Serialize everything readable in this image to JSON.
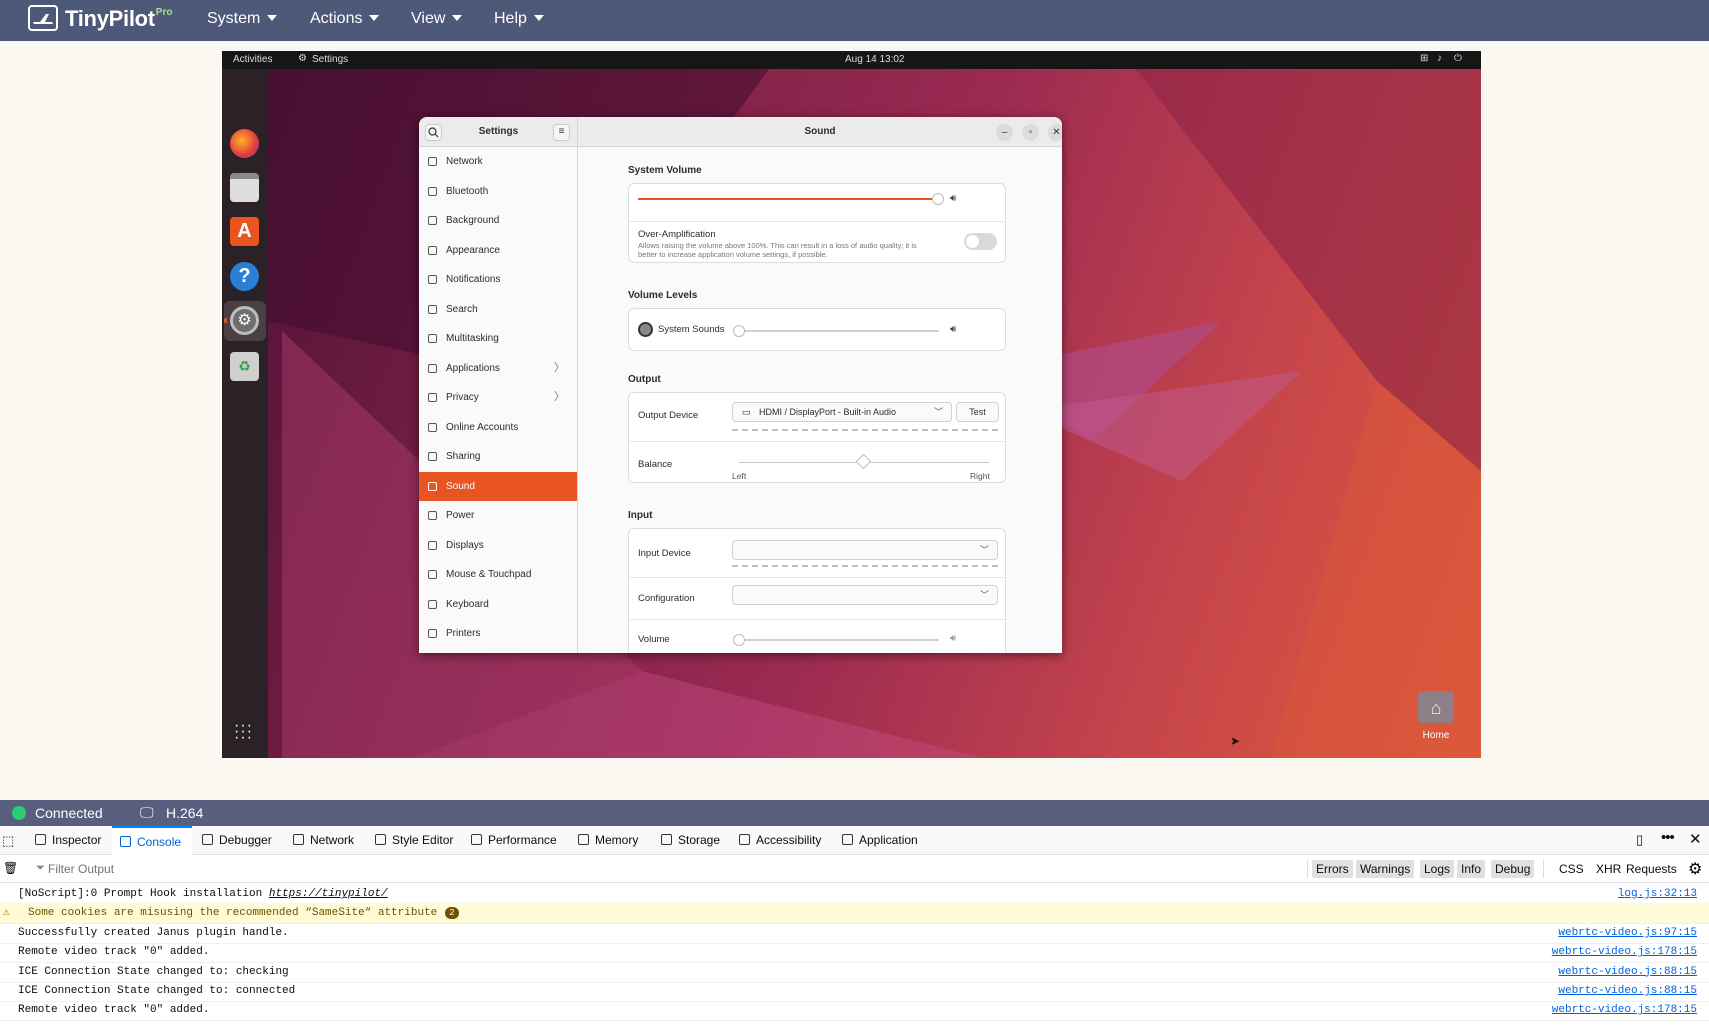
{
  "topbar": {
    "logo_text": "TinyPilot",
    "logo_pro": "Pro",
    "menus": [
      "System",
      "Actions",
      "View",
      "Help"
    ]
  },
  "remote": {
    "gnome_bar": {
      "activities": "Activities",
      "app": "Settings",
      "clock": "Aug 14  13:02"
    },
    "desktop_home_label": "Home",
    "settings": {
      "sidebar_title": "Settings",
      "panel_title": "Sound",
      "sidebar_items": [
        {
          "label": "Network",
          "chevron": ""
        },
        {
          "label": "Bluetooth",
          "chevron": ""
        },
        {
          "label": "Background",
          "chevron": ""
        },
        {
          "label": "Appearance",
          "chevron": ""
        },
        {
          "label": "Notifications",
          "chevron": ""
        },
        {
          "label": "Search",
          "chevron": ""
        },
        {
          "label": "Multitasking",
          "chevron": ""
        },
        {
          "label": "Applications",
          "chevron": "〉"
        },
        {
          "label": "Privacy",
          "chevron": "〉"
        },
        {
          "label": "Online Accounts",
          "chevron": ""
        },
        {
          "label": "Sharing",
          "chevron": ""
        },
        {
          "label": "Sound",
          "chevron": ""
        },
        {
          "label": "Power",
          "chevron": ""
        },
        {
          "label": "Displays",
          "chevron": ""
        },
        {
          "label": "Mouse & Touchpad",
          "chevron": ""
        },
        {
          "label": "Keyboard",
          "chevron": ""
        },
        {
          "label": "Printers",
          "chevron": ""
        }
      ],
      "active_item": "Sound",
      "system_volume_heading": "System Volume",
      "system_volume_level": 1.0,
      "over_amp_title": "Over-Amplification",
      "over_amp_desc": "Allows raising the volume above 100%. This can result in a loss of audio quality; it is better to increase application volume settings, if possible.",
      "over_amp_enabled": false,
      "volume_levels_heading": "Volume Levels",
      "system_sounds_label": "System Sounds",
      "system_sounds_level": 0.0,
      "output_heading": "Output",
      "output_device_label": "Output Device",
      "output_device_value": "HDMI / DisplayPort - Built-in Audio",
      "test_label": "Test",
      "balance_label": "Balance",
      "balance_left": "Left",
      "balance_right": "Right",
      "balance_value": 0.5,
      "input_heading": "Input",
      "input_device_label": "Input Device",
      "configuration_label": "Configuration",
      "volume_label": "Volume",
      "input_volume_level": 0.0
    }
  },
  "status": {
    "connected_label": "Connected",
    "codec": "H.264"
  },
  "devtools": {
    "tabs": [
      "Inspector",
      "Console",
      "Debugger",
      "Network",
      "Style Editor",
      "Performance",
      "Memory",
      "Storage",
      "Accessibility",
      "Application"
    ],
    "active_tab": "Console",
    "filter_placeholder": "Filter Output",
    "filters": [
      "Errors",
      "Warnings",
      "Logs",
      "Info",
      "Debug"
    ],
    "extra_filters": [
      "CSS",
      "XHR",
      "Requests"
    ],
    "logs": [
      {
        "text": "[NoScript]:0 Prompt Hook installation ",
        "link": "https://tinypilot/",
        "source": "log.js:32:13",
        "type": "log"
      },
      {
        "text": "Some cookies are misusing the recommended “SameSite“ attribute",
        "badge": "2",
        "source": "",
        "type": "warn"
      },
      {
        "text": "Successfully created Janus plugin handle.",
        "source": "webrtc-video.js:97:15",
        "type": "log"
      },
      {
        "text": "Remote video track \"0\" added.",
        "source": "webrtc-video.js:178:15",
        "type": "log"
      },
      {
        "text": "ICE Connection State changed to: checking",
        "source": "webrtc-video.js:88:15",
        "type": "log"
      },
      {
        "text": "ICE Connection State changed to: connected",
        "source": "webrtc-video.js:88:15",
        "type": "log"
      },
      {
        "text": "Remote video track \"0\" added.",
        "source": "webrtc-video.js:178:15",
        "type": "log"
      }
    ]
  },
  "colors": {
    "accent": "#e95420",
    "topbar": "#4e5878",
    "status_green": "#2ecc71",
    "devtools_blue": "#0060df"
  }
}
